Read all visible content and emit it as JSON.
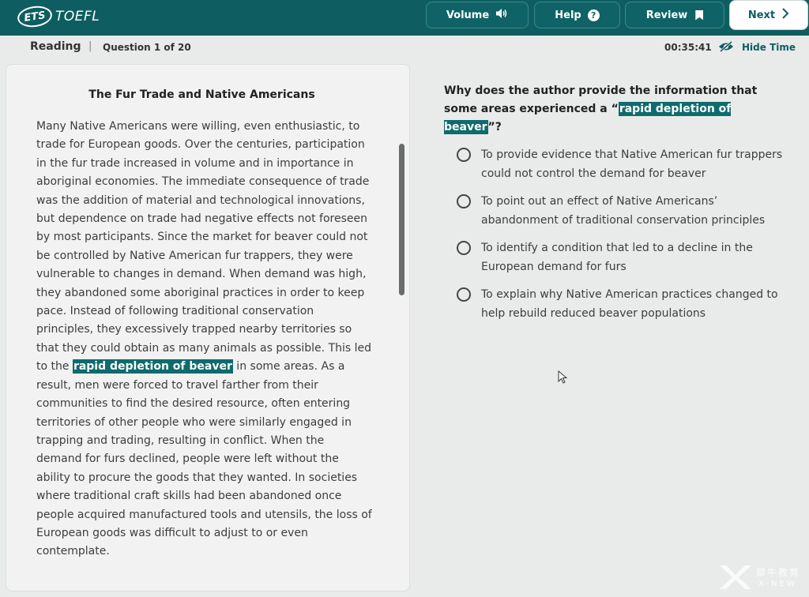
{
  "header": {
    "logo_ets": "ETS",
    "logo_product": "TOEFL",
    "buttons": {
      "volume": "Volume",
      "help": "Help",
      "review": "Review",
      "next": "Next"
    }
  },
  "subheader": {
    "section": "Reading",
    "separator": "|",
    "question_count": "Question 1 of 20",
    "timer": "00:35:41",
    "hide_time": "Hide Time"
  },
  "passage": {
    "title": "The Fur Trade and Native Americans",
    "text_before": "Many Native Americans were willing, even enthusiastic, to trade for European goods. Over the centuries, participation in the fur trade increased in volume and in importance in aboriginal economies. The immediate consequence of trade was the addition of material and technological innovations, but dependence on trade had negative effects not foreseen by most participants. Since the market for beaver could not be controlled by Native American fur trappers, they were vulnerable to changes in demand. When demand was high, they abandoned some aboriginal practices in order to keep pace. Instead of following traditional conservation principles, they excessively trapped nearby territories so that they could obtain as many animals as possible. This led to the ",
    "highlight": "rapid depletion of beaver",
    "text_after": " in some areas. As a result, men were forced to travel farther from their communities to find the desired resource, often entering territories of other people who were similarly engaged in trapping and trading, resulting in conflict. When the demand for furs declined, people were left without the ability to procure the goods that they wanted. In societies where traditional craft skills had been abandoned once people acquired manufactured tools and utensils, the loss of European goods was difficult to adjust to or even contemplate."
  },
  "question": {
    "prefix": "Why does the author provide the information that some areas experienced a “",
    "highlight": "rapid depletion of beaver",
    "suffix": "”?",
    "options": [
      "To provide evidence that Native American fur trappers could not control the demand for beaver",
      "To point out an effect of Native Americans’ abandonment of traditional conservation principles",
      "To identify a condition that led to a decline in the European demand for furs",
      "To explain why Native American practices changed to help rebuild reduced beaver populations"
    ]
  },
  "watermark": {
    "cn": "犀牛教育",
    "en": "X-NEW"
  },
  "colors": {
    "header_bg": "#0e5e61",
    "highlight_bg": "#0e6b6e",
    "page_bg": "#e9ebea"
  }
}
